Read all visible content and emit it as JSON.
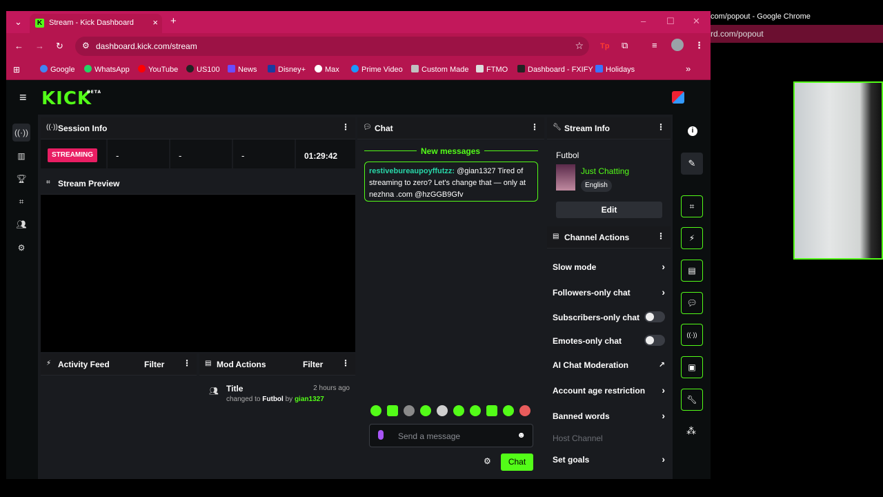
{
  "browser": {
    "tab_title": "Stream - Kick Dashboard",
    "url": "dashboard.kick.com/stream",
    "bookmarks": [
      {
        "label": "Google",
        "color": "#4285f4"
      },
      {
        "label": "WhatsApp",
        "color": "#25d366"
      },
      {
        "label": "YouTube",
        "color": "#ff0000"
      },
      {
        "label": "US100",
        "color": "#222222"
      },
      {
        "label": "News",
        "color": "#6a4cff"
      },
      {
        "label": "Disney+",
        "color": "#1a3aa0"
      },
      {
        "label": "Max",
        "color": "#111111"
      },
      {
        "label": "Prime Video",
        "color": "#1a98ff"
      },
      {
        "label": "Custom Made",
        "color": "#c0c0c0"
      },
      {
        "label": "FTMO",
        "color": "#111111"
      },
      {
        "label": "Dashboard - FXIFY",
        "color": "#222222"
      },
      {
        "label": "Holidays",
        "color": "#3b74ff"
      }
    ],
    "more_label": "»"
  },
  "popout": {
    "title": "com/popout - Google Chrome",
    "url": "rd.com/popout"
  },
  "brand": {
    "logo": "KICK",
    "beta": "BETA",
    "accent": "#53fc18"
  },
  "session_info": {
    "title": "Session Info",
    "status": "STREAMING",
    "stat1": "-",
    "stat2": "-",
    "stat3": "-",
    "uptime": "01:29:42"
  },
  "stream_preview": {
    "title": "Stream Preview"
  },
  "activity_feed": {
    "title": "Activity Feed",
    "filter": "Filter"
  },
  "mod_actions": {
    "title": "Mod Actions",
    "filter": "Filter",
    "item": {
      "heading": "Title",
      "time": "2 hours ago",
      "changed_to": "changed to",
      "value": "Futbol",
      "by": "by",
      "user": "gian1327"
    }
  },
  "chat": {
    "title": "Chat",
    "new_messages": "New messages",
    "message": {
      "user": "restivebureaupoyffutzz:",
      "text": "@gian1327 Tired of streaming to zero? Let's change that — only at nezhna .com @hzGGB9Gfv"
    },
    "input_placeholder": "Send a message",
    "send_label": "Chat"
  },
  "stream_info": {
    "title": "Stream Info",
    "stream_title": "Futbol",
    "category": "Just Chatting",
    "language": "English",
    "edit_label": "Edit"
  },
  "channel_actions": {
    "title": "Channel Actions",
    "items": [
      {
        "label": "Slow mode",
        "control": "chevron"
      },
      {
        "label": "Followers-only chat",
        "control": "chevron"
      },
      {
        "label": "Subscribers-only chat",
        "control": "toggle"
      },
      {
        "label": "Emotes-only chat",
        "control": "toggle"
      },
      {
        "label": "AI Chat Moderation",
        "control": "external"
      },
      {
        "label": "Account age restriction",
        "control": "chevron"
      },
      {
        "label": "Banned words",
        "control": "chevron"
      },
      {
        "label": "Host Channel",
        "control": "none"
      },
      {
        "label": "Set goals",
        "control": "chevron"
      }
    ]
  }
}
